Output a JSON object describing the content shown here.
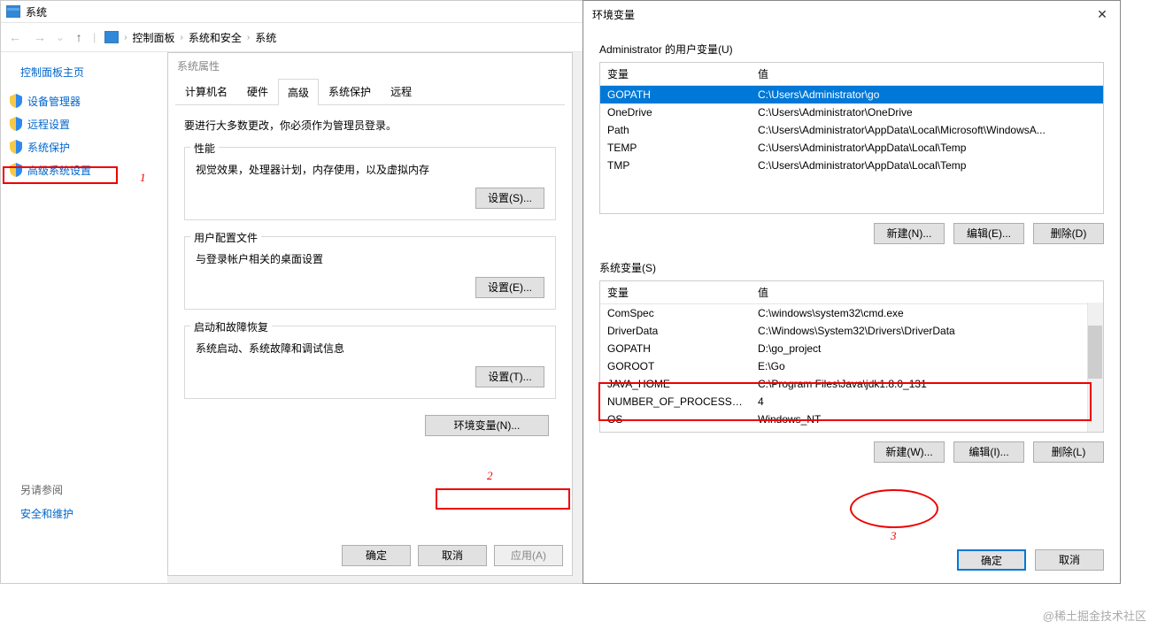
{
  "system_window": {
    "title": "系统",
    "breadcrumb": [
      "控制面板",
      "系统和安全",
      "系统"
    ]
  },
  "sidebar": {
    "home": "控制面板主页",
    "items": [
      {
        "label": "设备管理器"
      },
      {
        "label": "远程设置"
      },
      {
        "label": "系统保护"
      },
      {
        "label": "高级系统设置"
      }
    ],
    "bottom_label": "另请参阅",
    "bottom_link": "安全和维护"
  },
  "sysprop": {
    "title": "系统属性",
    "tabs": [
      "计算机名",
      "硬件",
      "高级",
      "系统保护",
      "远程"
    ],
    "active_tab": 2,
    "note": "要进行大多数更改，你必须作为管理员登录。",
    "sections": [
      {
        "legend": "性能",
        "desc": "视觉效果，处理器计划，内存使用，以及虚拟内存",
        "btn": "设置(S)..."
      },
      {
        "legend": "用户配置文件",
        "desc": "与登录帐户相关的桌面设置",
        "btn": "设置(E)..."
      },
      {
        "legend": "启动和故障恢复",
        "desc": "系统启动、系统故障和调试信息",
        "btn": "设置(T)..."
      }
    ],
    "env_btn": "环境变量(N)...",
    "ok": "确定",
    "cancel": "取消",
    "apply": "应用(A)"
  },
  "env": {
    "title": "环境变量",
    "user_group": "Administrator 的用户变量(U)",
    "sys_group": "系统变量(S)",
    "col_var": "变量",
    "col_val": "值",
    "user_vars": [
      {
        "name": "GOPATH",
        "value": "C:\\Users\\Administrator\\go",
        "selected": true
      },
      {
        "name": "OneDrive",
        "value": "C:\\Users\\Administrator\\OneDrive"
      },
      {
        "name": "Path",
        "value": "C:\\Users\\Administrator\\AppData\\Local\\Microsoft\\WindowsA..."
      },
      {
        "name": "TEMP",
        "value": "C:\\Users\\Administrator\\AppData\\Local\\Temp"
      },
      {
        "name": "TMP",
        "value": "C:\\Users\\Administrator\\AppData\\Local\\Temp"
      }
    ],
    "sys_vars": [
      {
        "name": "ComSpec",
        "value": "C:\\windows\\system32\\cmd.exe"
      },
      {
        "name": "DriverData",
        "value": "C:\\Windows\\System32\\Drivers\\DriverData"
      },
      {
        "name": "GOPATH",
        "value": "D:\\go_project"
      },
      {
        "name": "GOROOT",
        "value": "E:\\Go"
      },
      {
        "name": "JAVA_HOME",
        "value": "C:\\Program Files\\Java\\jdk1.8.0_131"
      },
      {
        "name": "NUMBER_OF_PROCESSORS",
        "value": "4"
      },
      {
        "name": "OS",
        "value": "Windows_NT"
      }
    ],
    "new_n": "新建(N)...",
    "edit_e": "编辑(E)...",
    "del_d": "删除(D)",
    "new_w": "新建(W)...",
    "edit_i": "编辑(I)...",
    "del_l": "删除(L)",
    "ok": "确定",
    "cancel": "取消"
  },
  "annotations": {
    "a1": "1",
    "a2": "2",
    "a3": "3"
  },
  "watermark": "@稀土掘金技术社区"
}
